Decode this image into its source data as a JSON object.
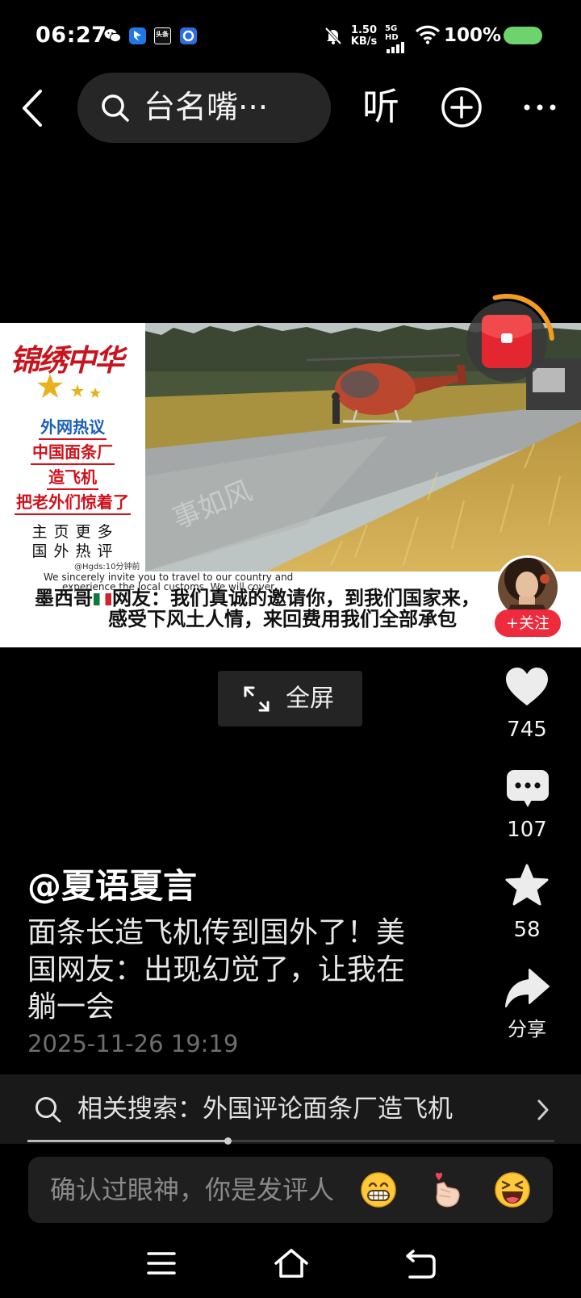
{
  "status_bar": {
    "time": "06:27",
    "toutiao_badge": "头条",
    "net_speed_value": "1.50",
    "net_speed_unit": "KB/s",
    "network_type": "5G HD",
    "battery_text": "100%",
    "icons": [
      "wechat-icon",
      "blue-app-icon",
      "toutiao-app-icon",
      "circle-app-icon",
      "mute-bell-icon",
      "signal-icon",
      "wifi-icon",
      "battery-icon"
    ]
  },
  "top_nav": {
    "search_text": "台名嘴···",
    "listen_label": "听",
    "icons": [
      "chevron-left-icon",
      "search-icon",
      "plus-circle-icon",
      "more-icon"
    ]
  },
  "video": {
    "poster": {
      "title": "锦绣中华",
      "tag": "外网热议",
      "headline_lines": [
        "中国面条厂",
        "造飞机",
        "把老外们惊着了"
      ],
      "more_row1": "主 页 更 多",
      "more_row2": "国 外 热 评"
    },
    "watermark": "事如风",
    "subtitle_small": "@Hgds:10分钟前",
    "subtitle_en_lines": [
      "We sincerely invite you to travel to our country and",
      "experience the local customs. We will cover"
    ],
    "subtitle_cn_line1_prefix": "墨西哥",
    "subtitle_cn_line1_rest": "网友：我们真诚的邀请你，到我们国家来，",
    "subtitle_cn_line2": "感受下风土人情，来回费用我们全部承包",
    "red_packet": {
      "icon": "red-envelope-icon",
      "progress": 0.28
    },
    "follow_label": "+关注"
  },
  "fullscreen_label": "全屏",
  "actions": {
    "likes": "745",
    "comments": "107",
    "favorites": "58",
    "share_label": "分享",
    "icons": [
      "heart-icon",
      "comment-icon",
      "star-icon",
      "share-icon"
    ]
  },
  "post": {
    "author": "@夏语夏言",
    "description": "面条长造飞机传到国外了！美国网友：出现幻觉了，让我在躺一会",
    "timestamp": "2025-11-26 19:19"
  },
  "related_search": {
    "label": "相关搜索：外国评论面条厂造飞机"
  },
  "playback": {
    "progress": 0.38
  },
  "comment_bar": {
    "placeholder": "确认过眼神，你是发评人",
    "emojis": [
      "grinning-face-icon",
      "finger-heart-icon",
      "laughing-face-icon"
    ]
  },
  "bottom_nav": {
    "icons": [
      "menu-icon",
      "home-icon",
      "back-icon"
    ]
  },
  "colors": {
    "background": "#000000",
    "battery_green": "#6fd36d",
    "accent_red": "#ee2a3d",
    "red_packet_ring": "#f39c1f"
  }
}
